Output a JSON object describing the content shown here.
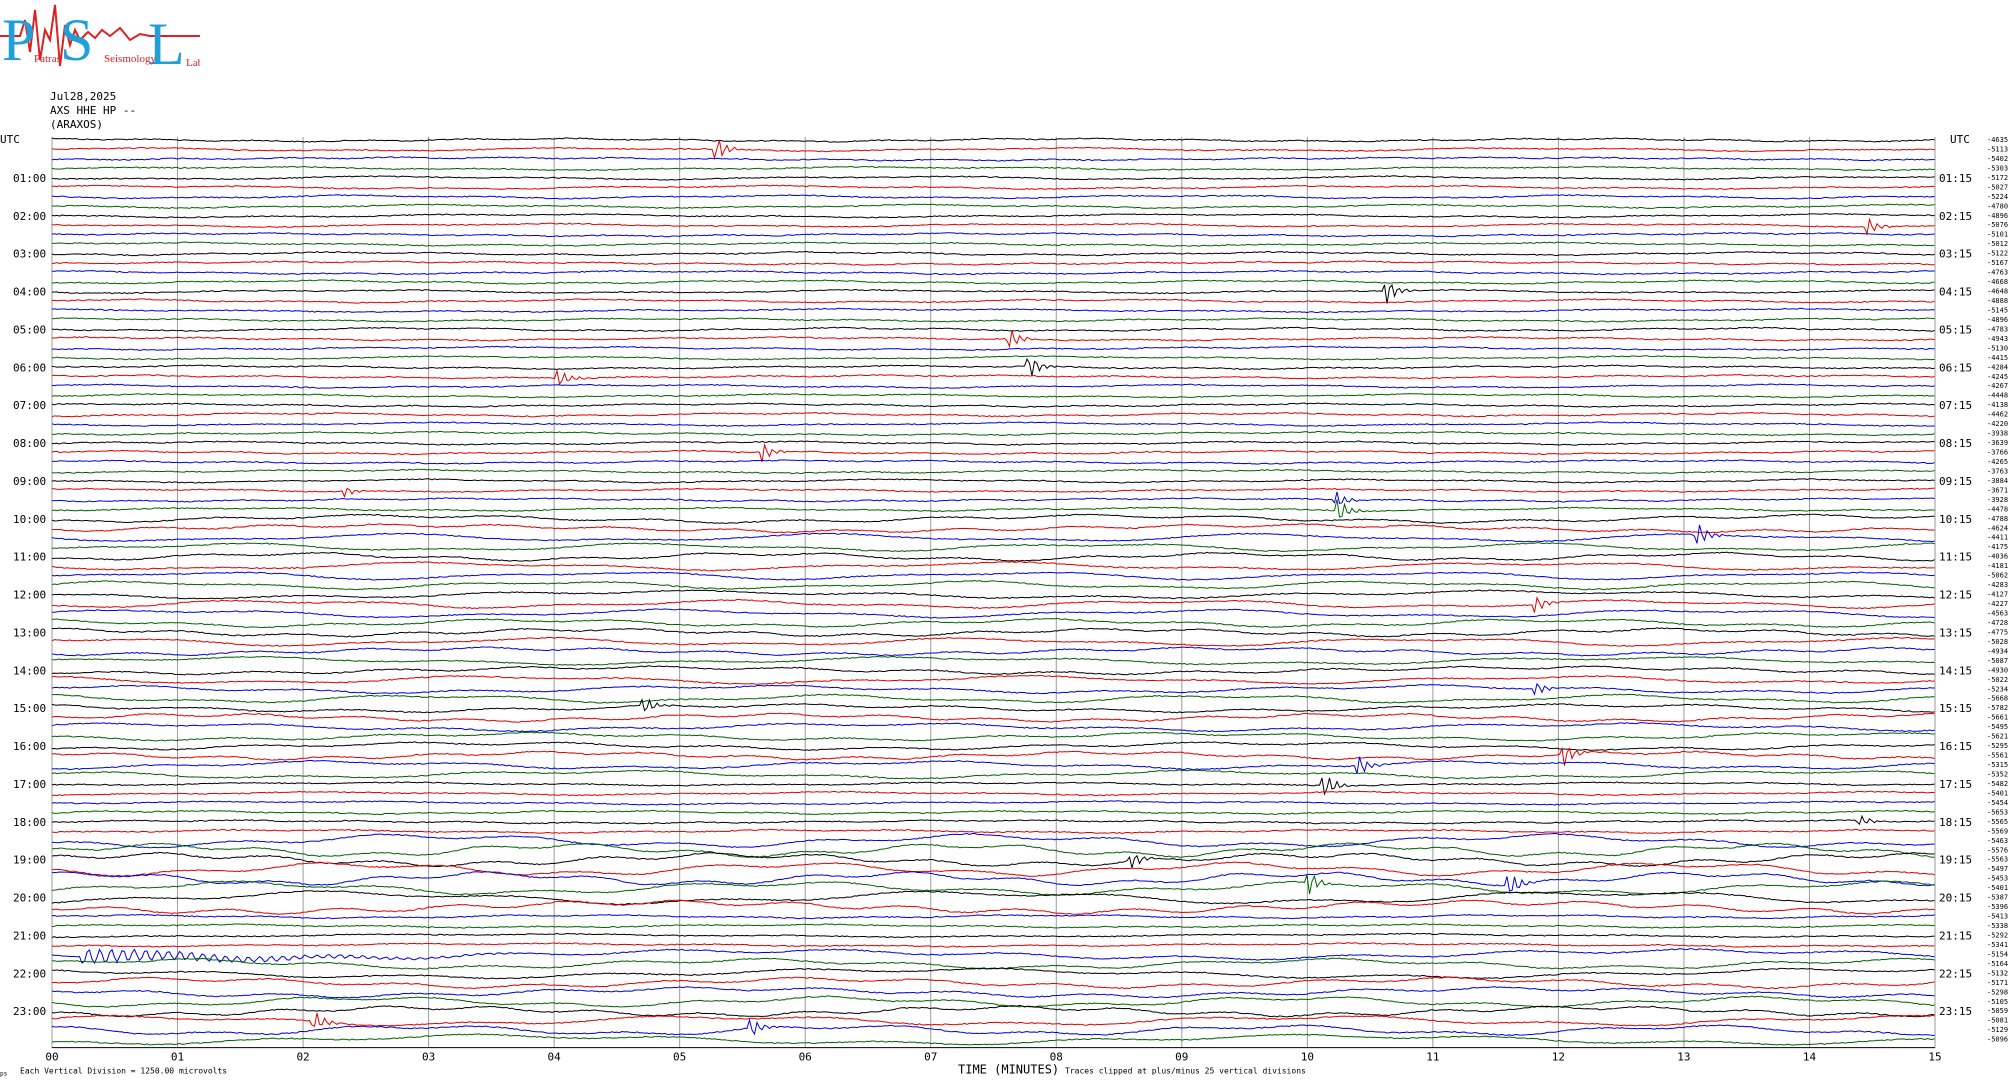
{
  "logo": {
    "letters": [
      "P",
      "S",
      "L"
    ],
    "small_words": [
      "Patras",
      "Seismology",
      "Lab"
    ]
  },
  "header": {
    "date": "Jul28,2025",
    "station": "AXS HHE HP --",
    "station_name": "(ARAXOS)"
  },
  "chart_data": {
    "type": "line",
    "title": "",
    "left_axis_label": "UTC",
    "right_axis_label": "UTC",
    "left_hour_labels": [
      "01:00",
      "02:00",
      "03:00",
      "04:00",
      "05:00",
      "06:00",
      "07:00",
      "08:00",
      "09:00",
      "10:00",
      "11:00",
      "12:00",
      "13:00",
      "14:00",
      "15:00",
      "16:00",
      "17:00",
      "18:00",
      "19:00",
      "20:00",
      "21:00",
      "22:00",
      "23:00"
    ],
    "right_hour_labels": [
      "01:15",
      "02:15",
      "03:15",
      "04:15",
      "05:15",
      "06:15",
      "07:15",
      "08:15",
      "09:15",
      "10:15",
      "11:15",
      "12:15",
      "13:15",
      "14:15",
      "15:15",
      "16:15",
      "17:15",
      "18:15",
      "19:15",
      "20:15",
      "21:15",
      "22:15",
      "23:15"
    ],
    "x_ticks": [
      "00",
      "01",
      "02",
      "03",
      "04",
      "05",
      "06",
      "07",
      "08",
      "09",
      "10",
      "11",
      "12",
      "13",
      "14",
      "15"
    ],
    "xlabel": "TIME (MINUTES)",
    "xlim": [
      0,
      15
    ],
    "trace_colors": [
      "#000000",
      "#e00000",
      "#0000e0",
      "#006400"
    ],
    "trace_count": 96,
    "trace_offsets": [
      "-4635",
      "-5113",
      "-5402",
      "-5303",
      "-5172",
      "-5027",
      "-5224",
      "-4780",
      "-4896",
      "-5076",
      "-5101",
      "-5012",
      "-5122",
      "-5167",
      "-4763",
      "-4668",
      "-4648",
      "-4888",
      "-5145",
      "-4896",
      "-4783",
      "-4943",
      "-5130",
      "-4415",
      "-4284",
      "-4245",
      "-4267",
      "-4448",
      "-4138",
      "-4462",
      "-4220",
      "-3938",
      "-3639",
      "-3766",
      "-4265",
      "-3763",
      "-3884",
      "-3671",
      "-3928",
      "-4478",
      "-4788",
      "-4624",
      "-4411",
      "-4175",
      "-4036",
      "-4181",
      "-5062",
      "-4283",
      "-4127",
      "-4227",
      "-4563",
      "-4728",
      "-4775",
      "-5028",
      "-4934",
      "-5087",
      "-4930",
      "-5022",
      "-5234",
      "-5668",
      "-5782",
      "-5661",
      "-5495",
      "-5621",
      "-5295",
      "-5561",
      "-5315",
      "-5352",
      "-5482",
      "-5401",
      "-5454",
      "-5653",
      "-5565",
      "-5569",
      "-5463",
      "-5576",
      "-5563",
      "-5497",
      "-5453",
      "-5401",
      "-5387",
      "-5396",
      "-5413",
      "-5338",
      "-5292",
      "-5341",
      "-5154",
      "-5164",
      "-5132",
      "-5171",
      "-5298",
      "-5105",
      "-5059",
      "-5081",
      "-5129",
      "-5096"
    ],
    "footer_left": "Each Vertical Division = 1250.00 microvolts",
    "footer_note": "Traces clipped at plus/minus 25 vertical divisions",
    "corner_mark": "ps"
  }
}
